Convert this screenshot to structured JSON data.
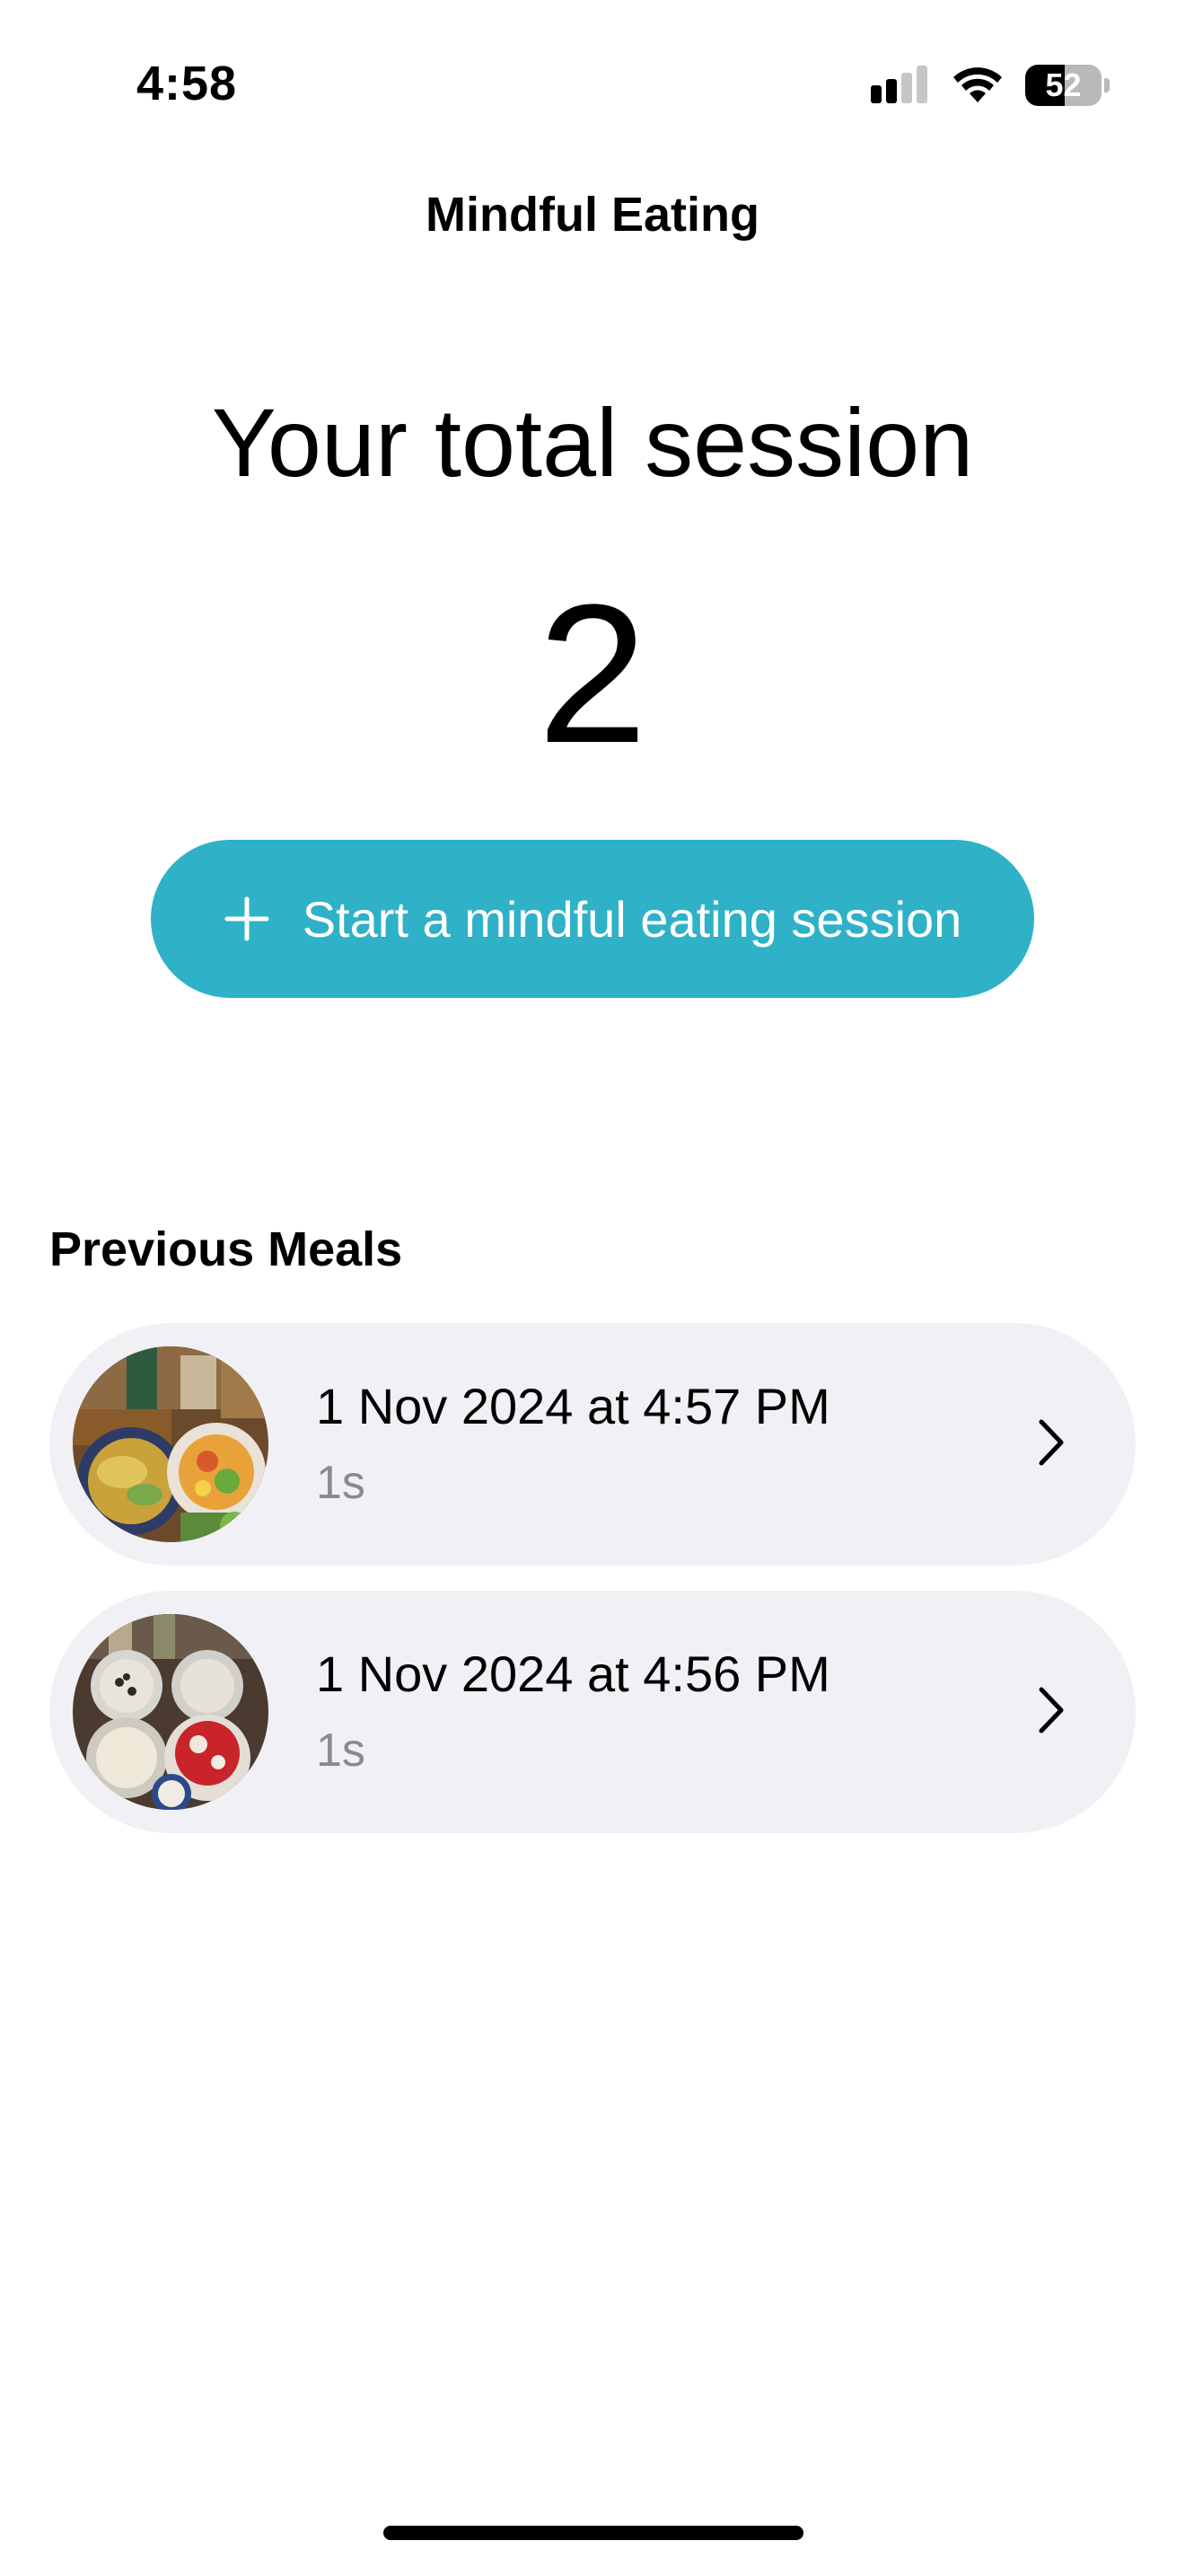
{
  "status_bar": {
    "time": "4:58",
    "battery_level": "52",
    "battery_fill_fraction": 0.52,
    "icons": [
      "signal-icon",
      "wifi-icon",
      "battery-icon"
    ]
  },
  "nav": {
    "title": "Mindful Eating"
  },
  "summary": {
    "heading": "Your total session",
    "count": "2"
  },
  "start_button": {
    "icon": "plus-icon",
    "label": "Start a mindful eating session",
    "color": "#2fb1c7"
  },
  "previous_meals": {
    "title": "Previous Meals",
    "items": [
      {
        "date": "1 Nov 2024 at 4:57 PM",
        "duration": "1s",
        "thumbnail": "meal-photo"
      },
      {
        "date": "1 Nov 2024 at 4:56 PM",
        "duration": "1s",
        "thumbnail": "dessert-photo"
      }
    ]
  },
  "colors": {
    "accent": "#2fb1c7",
    "card_background": "#f1f0f5",
    "secondary_text": "#8a8a8e"
  }
}
